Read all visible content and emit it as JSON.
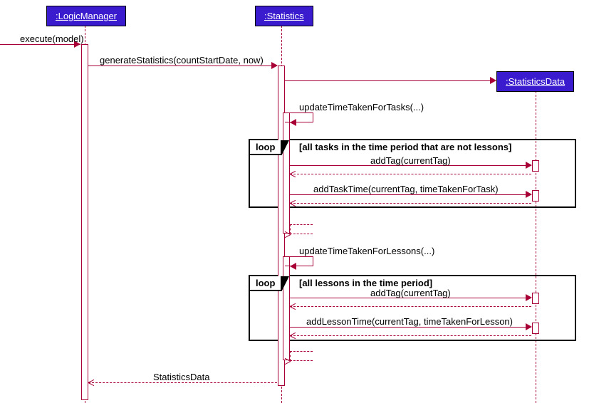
{
  "participants": {
    "logicManager": ":LogicManager",
    "statistics": ":Statistics",
    "statisticsData": ":StatisticsData"
  },
  "messages": {
    "execute": "execute(model)",
    "generate": "generateStatistics(countStartDate, now)",
    "updateTasks": "updateTimeTakenForTasks(...)",
    "addTagCur": "addTag(currentTag)",
    "addTaskTime": "addTaskTime(currentTag, timeTakenForTask)",
    "updateLessons": "updateTimeTakenForLessons(...)",
    "addLessonTime": "addLessonTime(currentTag, timeTakenForLesson)",
    "returnData": "StatisticsData"
  },
  "loops": {
    "loopLabel": "loop",
    "tasksGuard": "[all tasks in the time period that are not lessons]",
    "lessonsGuard": "[all lessons in the time period]"
  }
}
